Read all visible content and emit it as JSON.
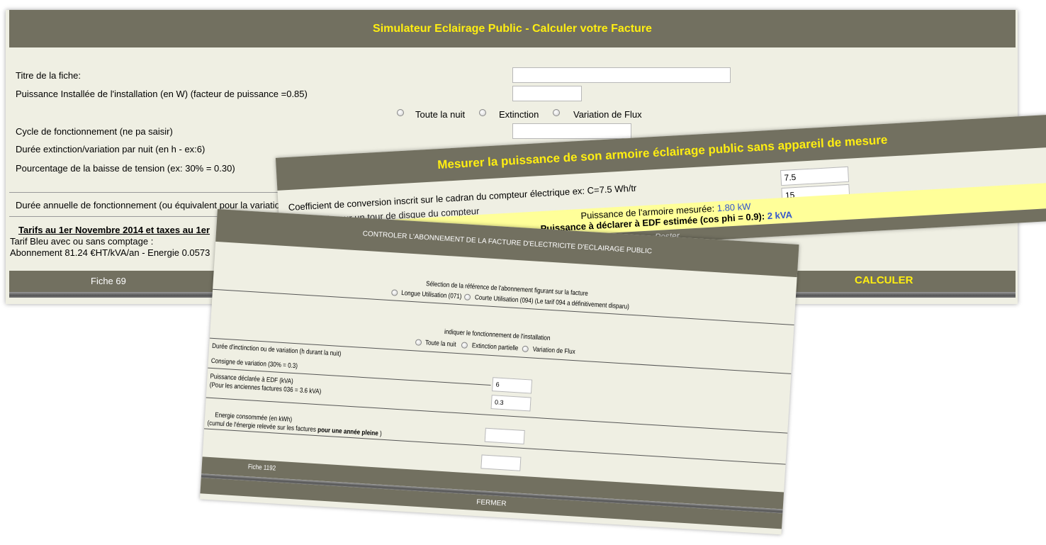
{
  "simulateur": {
    "title": "Simulateur Eclairage Public - Calculer votre Facture",
    "fields": {
      "titre": "Titre de la fiche:",
      "puissance": "Puissance Installée de l'installation (en W) (facteur de puissance =0.85)",
      "cycle": "Cycle de fonctionnement (ne pa saisir)",
      "duree": "Durée extinction/variation par nuit (en h - ex:6)",
      "pourcentage": "Pourcentage de la baisse de tension (ex: 30% = 0.30)",
      "annuelle": "Durée annuelle de fonctionnement (ou équivalent pour la variation"
    },
    "radio_options": [
      "Toute la nuit",
      "Extinction",
      "Variation de Flux"
    ],
    "tarifs_title": "Tarifs au 1er Novembre 2014 et taxes au 1er",
    "tarifs_line1": "Tarif Bleu avec ou sans comptage :",
    "tarifs_line2": "Abonnement 81.24 €HT/kVA/an - Energie 0.0573",
    "fiche": "Fiche 69",
    "calculer": "CALCULER"
  },
  "mesurer": {
    "title": "Mesurer la puissance de son armoire éclairage public sans appareil de mesure",
    "coef_label": "Coefficient de conversion inscrit sur le cadran du compteur électrique ex: C=7.5 Wh/tr",
    "temps_label": "...ré (en s) pour un tour de disque du compteur",
    "coef_value": "7.5",
    "temps_value": "15",
    "mesuree_label": "Puissance de l'armoire mesurée:",
    "mesuree_value": "1.80 kW",
    "declarer_label": "Puissance à déclarer à EDF estimée (cos phi = 0.9):",
    "declarer_value": "2 kVA",
    "poster": "Poster"
  },
  "controler": {
    "title": "CONTROLER L'ABONNEMENT DE LA FACTURE D'ELECTRICITE D'ECLAIRAGE PUBLIC",
    "selection_label": "Sélection de la référence de l'abonnement figurant sur la facture",
    "abonnement_options": [
      "Longue Utilisation (071)",
      "Courte Utilisation (094) (Le tarif 094 a définitivement disparu)"
    ],
    "fonctionnement_label": "indiquer le fonctionnement de l'installation",
    "fonctionnement_options": [
      "Toute la nuit",
      "Extinction partielle",
      "Variation de Flux"
    ],
    "duree_label": "Durée d'inctinction ou de variation (h durant la nuit)",
    "consigne_label": "Consigne de variation (30% = 0.3)",
    "duree_value": "6",
    "consigne_value": "0.3",
    "puissance_label": "Puissance déclarée à EDF (kVA)",
    "puissance_note": "(Pour les anciennes factures 036 = 3.6 kVA)",
    "energie_label": "Energie consommée (en kWh)",
    "energie_note_a": "(cumul de l'énergie relevée sur les factures ",
    "energie_note_b": "pour une année pleine",
    "energie_note_c": " )",
    "fiche": "Fiche 1192",
    "fermer": "FERMER"
  }
}
